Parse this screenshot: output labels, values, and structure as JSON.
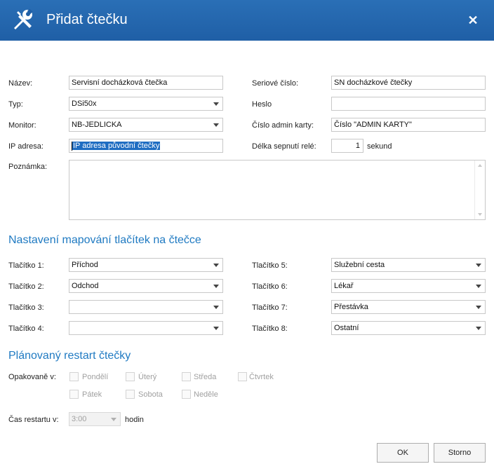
{
  "window": {
    "title": "Přidat čtečku",
    "close_glyph": "✕",
    "icon": "wrench-screwdriver-icon"
  },
  "form": {
    "name_label": "Název:",
    "name_value": "Servisní docházková čtečka",
    "serial_label": "Seriové číslo:",
    "serial_value": "SN docházkové čtečky",
    "type_label": "Typ:",
    "type_value": "DSi50x",
    "password_label": "Heslo",
    "password_value": "",
    "monitor_label": "Monitor:",
    "monitor_value": "NB-JEDLICKA",
    "admin_card_label": "Číslo admin karty:",
    "admin_card_value": "Číslo \"ADMIN KARTY\"",
    "ip_label": "IP adresa:",
    "ip_value": "IP adresa původní čtečky",
    "relay_label": "Délka sepnutí relé:",
    "relay_value": "1",
    "relay_unit": "sekund",
    "note_label": "Poznámka:",
    "note_value": ""
  },
  "mapping": {
    "section_title": "Nastavení mapování tlačítek na čtečce",
    "buttons": [
      {
        "label": "Tlačítko 1:",
        "value": "Příchod"
      },
      {
        "label": "Tlačítko 2:",
        "value": "Odchod"
      },
      {
        "label": "Tlačítko 3:",
        "value": ""
      },
      {
        "label": "Tlačítko 4:",
        "value": ""
      },
      {
        "label": "Tlačítko 5:",
        "value": "Služební cesta"
      },
      {
        "label": "Tlačítko 6:",
        "value": "Lékař"
      },
      {
        "label": "Tlačítko 7:",
        "value": "Přestávka"
      },
      {
        "label": "Tlačítko 8:",
        "value": "Ostatní"
      }
    ]
  },
  "restart": {
    "section_title": "Plánovaný restart čtečky",
    "repeat_label": "Opakovaně v:",
    "days": [
      {
        "label": "Pondělí",
        "checked": false
      },
      {
        "label": "Úterý",
        "checked": false
      },
      {
        "label": "Středa",
        "checked": false
      },
      {
        "label": "Čtvrtek",
        "checked": false
      },
      {
        "label": "Pátek",
        "checked": false
      },
      {
        "label": "Sobota",
        "checked": false
      },
      {
        "label": "Neděle",
        "checked": false
      }
    ],
    "time_label": "Čas restartu v:",
    "time_value": "3:00",
    "time_unit": "hodin"
  },
  "footer": {
    "ok_label": "OK",
    "cancel_label": "Storno"
  },
  "colors": {
    "titlebar": "#1f5fa6",
    "section_title": "#1f7ac2",
    "selection": "#1f6dc2"
  }
}
